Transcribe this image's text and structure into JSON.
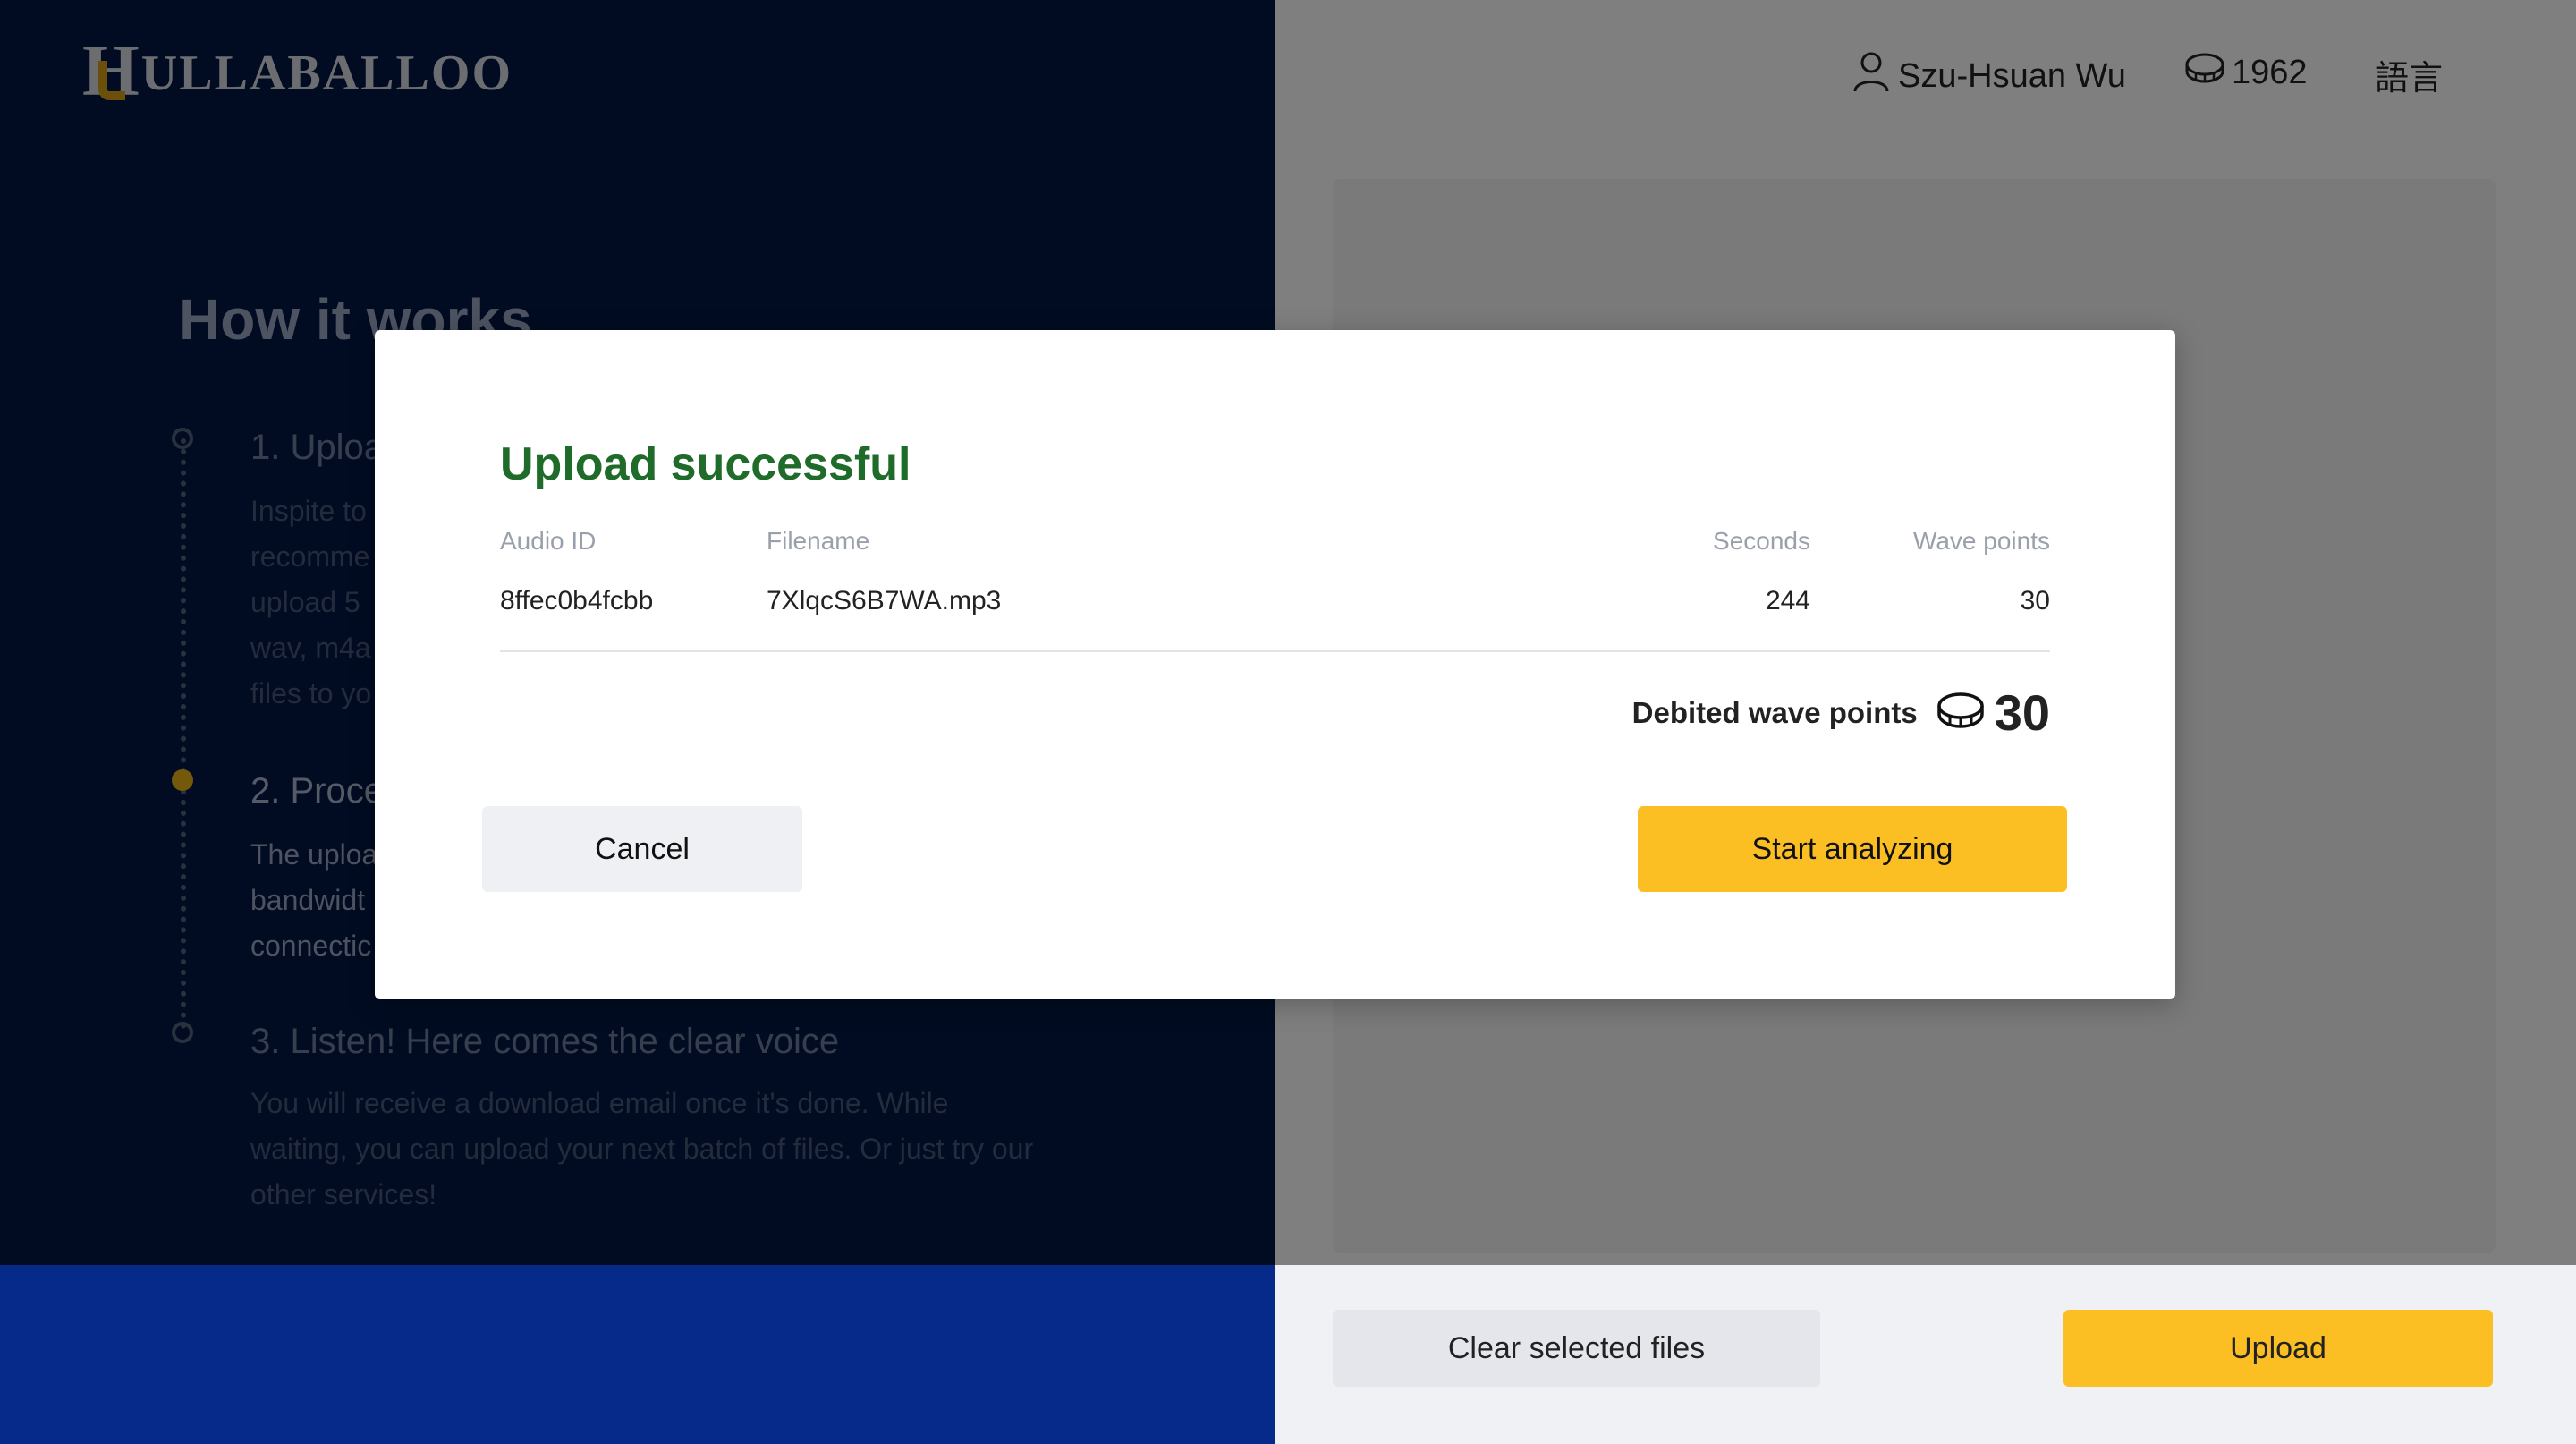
{
  "brand": {
    "logo_initial": "H",
    "logo_rest": "ULLABALLOO"
  },
  "header": {
    "username": "Szu-Hsuan Wu",
    "points": "1962",
    "language_label": "語言"
  },
  "how_it_works": {
    "title": "How it works",
    "steps": [
      {
        "title": "1. Uploa",
        "text_lines": [
          "Inspite to",
          "recomme",
          "upload 5",
          "wav, m4a",
          "files to yo"
        ]
      },
      {
        "title": "2. Proce",
        "text_lines": [
          "The uploa",
          "bandwidt",
          "connectic"
        ]
      },
      {
        "title": "3. Listen! Here comes the clear voice",
        "text_lines": [
          "You will receive a download email once it's done. While",
          "waiting, you can upload your next batch of files. Or just try our",
          "other services!"
        ]
      }
    ]
  },
  "actions": {
    "clear_label": "Clear selected files",
    "upload_label": "Upload"
  },
  "modal": {
    "title": "Upload successful",
    "columns": {
      "audio_id": "Audio ID",
      "filename": "Filename",
      "seconds": "Seconds",
      "wave_points": "Wave points"
    },
    "row": {
      "audio_id": "8ffec0b4fcbb",
      "filename": "7XlqcS6B7WA.mp3",
      "seconds": "244",
      "wave_points": "30"
    },
    "debit_label": "Debited wave points",
    "debit_value": "30",
    "cancel_label": "Cancel",
    "start_label": "Start analyzing"
  },
  "colors": {
    "accent_yellow": "#fbbf24",
    "success_green": "#1f6b2a",
    "navy": "#031845"
  }
}
